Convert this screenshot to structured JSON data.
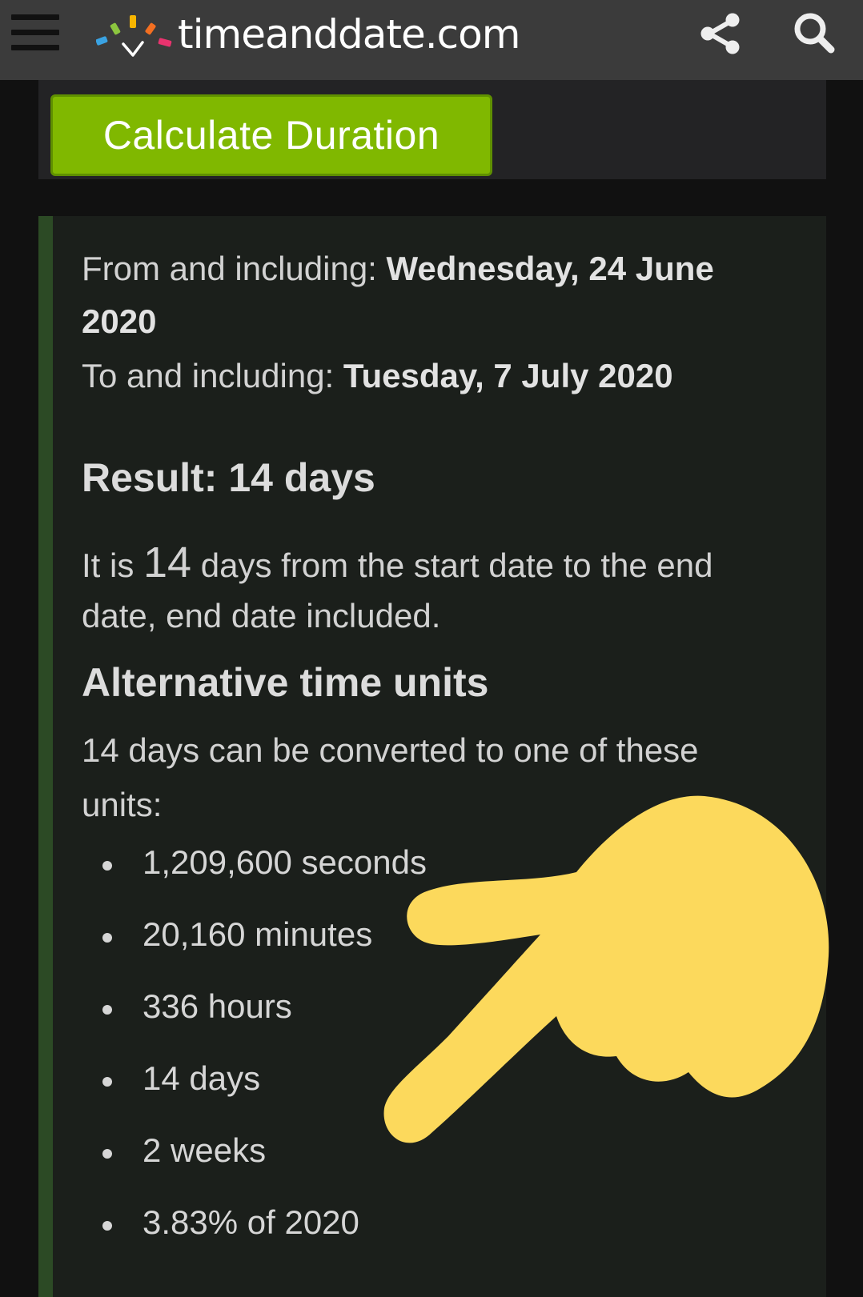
{
  "header": {
    "site_name": "timeanddate.com",
    "menu_icon": "hamburger-menu-icon",
    "share_icon": "share-icon",
    "search_icon": "search-icon",
    "logo_colors": [
      "#3aa3e3",
      "#8cc63f",
      "#f7b500",
      "#f36f21",
      "#e8336e"
    ]
  },
  "calculator": {
    "button_label": "Calculate Duration",
    "button_color": "#80b800"
  },
  "result": {
    "from_label": "From and including: ",
    "from_date_line1": "Wednesday, 24 June",
    "from_date_line2": "2020",
    "to_label": "To and including: ",
    "to_date": "Tuesday, 7 July 2020",
    "heading": "Result: 14 days",
    "desc_prefix": "It is ",
    "desc_number": "14",
    "desc_line1_suffix": " days from the start date to the end",
    "desc_line2": "date, end date included.",
    "alt_heading": "Alternative time units",
    "alt_desc_line1": "14 days can be converted to one of these",
    "alt_desc_line2": "units:",
    "units": [
      "1,209,600 seconds",
      "20,160 minutes",
      "336 hours",
      "14 days",
      "2 weeks",
      "3.83% of 2020"
    ]
  },
  "overlay": {
    "emoji": "pointing-hand-icon",
    "color": "#fcd95c"
  }
}
